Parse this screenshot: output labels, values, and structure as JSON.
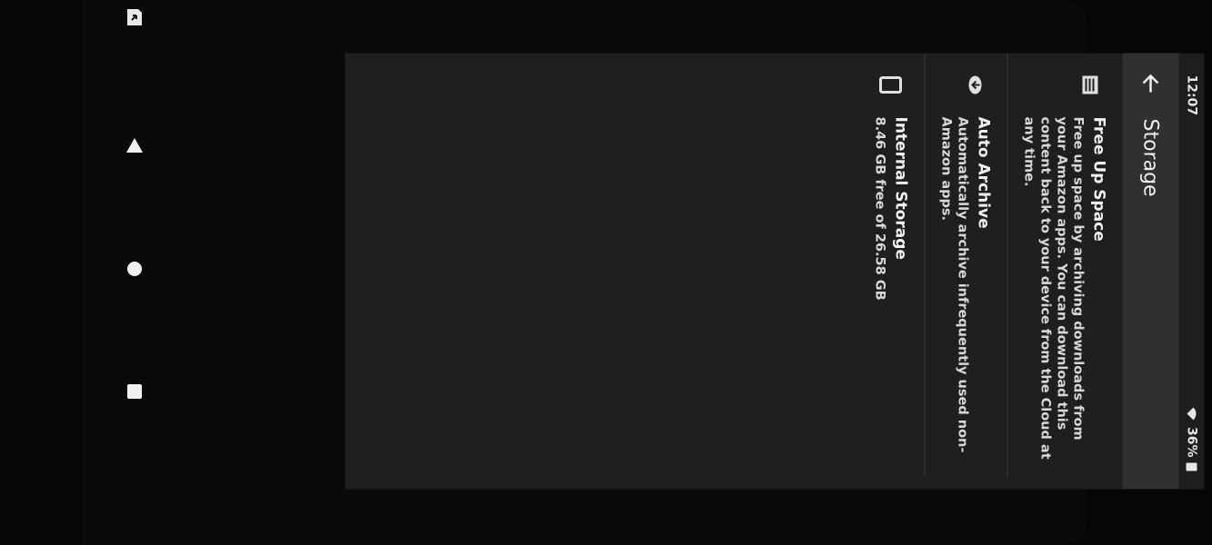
{
  "status_bar": {
    "time": "12:07",
    "battery_percent": "36%",
    "wifi_icon": "wifi-icon",
    "battery_icon": "battery-icon"
  },
  "app_bar": {
    "title": "Storage",
    "back_icon": "arrow-left-icon"
  },
  "items": [
    {
      "title": "Free Up Space",
      "description": "Free up space by archiving downloads from your Amazon apps. You can download this content back to your device from the Cloud at any time.",
      "icon": "archive-box-icon"
    },
    {
      "title": "Auto Archive",
      "description": "Automatically archive infrequently used non-Amazon apps.",
      "icon": "cloud-icon"
    },
    {
      "title": "Internal Storage",
      "description": "8.46 GB free of 26.58 GB",
      "icon": "phone-storage-icon"
    }
  ],
  "nav_bar": {
    "buttons": [
      "back-triangle-icon",
      "home-circle-icon",
      "recents-square-icon"
    ],
    "share_icon": "share-icon"
  },
  "colors": {
    "screen_bg": "#1f1f20",
    "appbar_bg": "#303032",
    "text": "#e4e4e4"
  }
}
